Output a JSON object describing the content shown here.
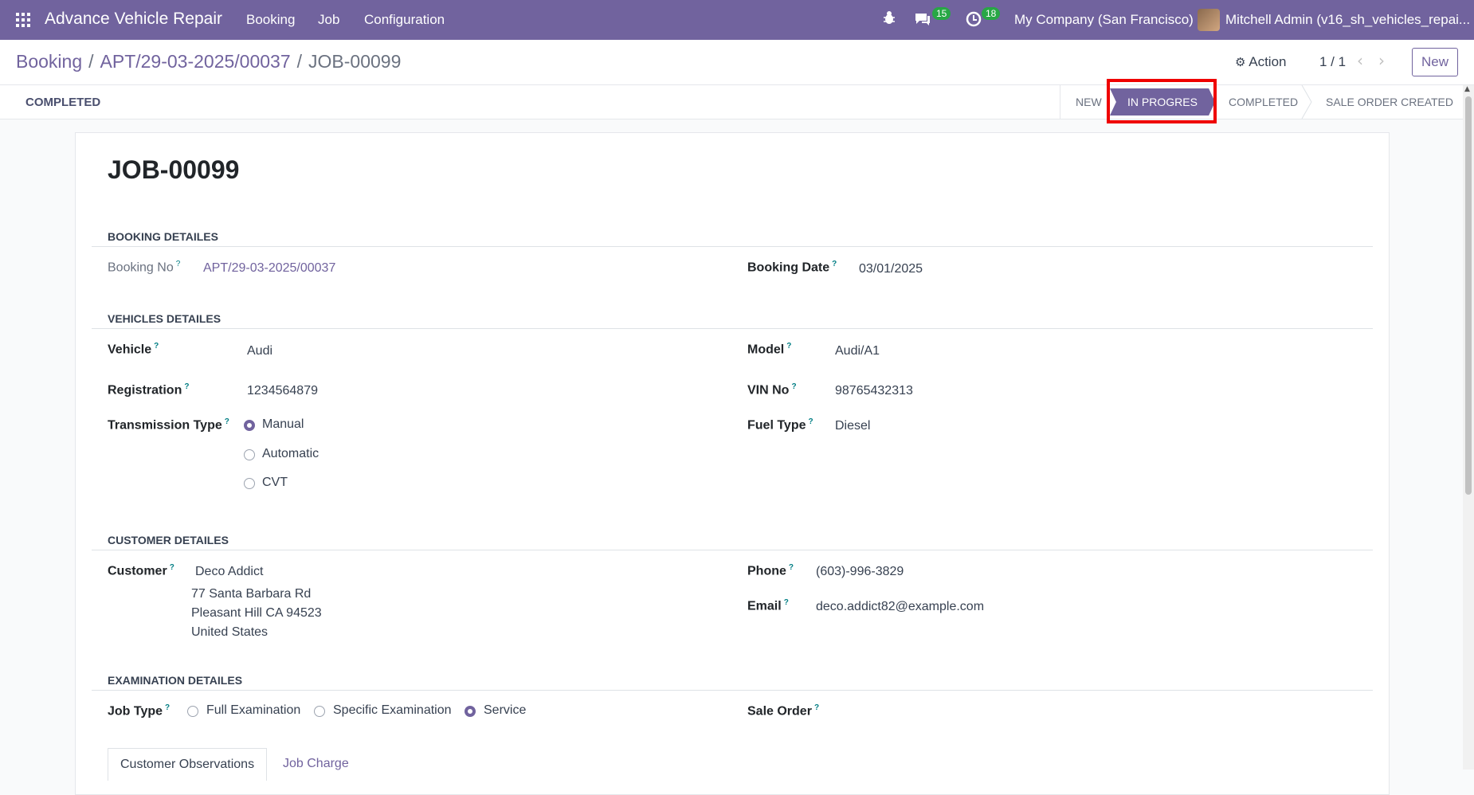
{
  "navbar": {
    "app_name": "Advance Vehicle Repair",
    "menu": [
      "Booking",
      "Job",
      "Configuration"
    ],
    "messages_count": "15",
    "activities_count": "18",
    "company": "My Company (San Francisco)",
    "user": "Mitchell Admin (v16_sh_vehicles_repai..."
  },
  "breadcrumb": {
    "items": [
      "Booking",
      "APT/29-03-2025/00037"
    ],
    "separator": "/",
    "current": "JOB-00099"
  },
  "controls": {
    "action_label": "Action",
    "pager": "1 / 1",
    "new_label": "New"
  },
  "statusbar": {
    "button_label": "COMPLETED",
    "stages": [
      "NEW",
      "IN PROGRES",
      "COMPLETED",
      "SALE ORDER CREATED"
    ],
    "active_stage": "IN PROGRES"
  },
  "record": {
    "title": "JOB-00099",
    "sections": {
      "booking": "BOOKING DETAILES",
      "vehicles": "VEHICLES DETAILES",
      "customer": "CUSTOMER DETAILES",
      "examination": "EXAMINATION DETAILES"
    },
    "booking_no_label": "Booking No",
    "booking_no": "APT/29-03-2025/00037",
    "booking_date_label": "Booking Date",
    "booking_date": "03/01/2025",
    "vehicle_label": "Vehicle",
    "vehicle": "Audi",
    "model_label": "Model",
    "model": "Audi/A1",
    "registration_label": "Registration",
    "registration": "1234564879",
    "vin_label": "VIN No",
    "vin": "98765432313",
    "transmission_label": "Transmission Type",
    "transmission_options": [
      "Manual",
      "Automatic",
      "CVT"
    ],
    "transmission_selected": "Manual",
    "fuel_label": "Fuel Type",
    "fuel": "Diesel",
    "customer_label": "Customer",
    "customer_name": "Deco Addict",
    "customer_address": [
      "77 Santa Barbara Rd",
      "Pleasant Hill CA 94523",
      "United States"
    ],
    "phone_label": "Phone",
    "phone": "(603)-996-3829",
    "email_label": "Email",
    "email": "deco.addict82@example.com",
    "job_type_label": "Job Type",
    "job_type_options": [
      "Full Examination",
      "Specific Examination",
      "Service"
    ],
    "job_type_selected": "Service",
    "sale_order_label": "Sale Order",
    "help_mark": "?"
  },
  "tabs": [
    "Customer Observations",
    "Job Charge"
  ],
  "colors": {
    "primary": "#71639e",
    "navbar": "#71639e",
    "badge": "#28a745",
    "highlight": "#ef0000",
    "help": "#017e84"
  },
  "icons": {
    "apps": "apps-grid-icon",
    "bug": "bug-icon",
    "chat": "chat-icon",
    "clock": "clock-icon",
    "gear": "gear-icon"
  }
}
